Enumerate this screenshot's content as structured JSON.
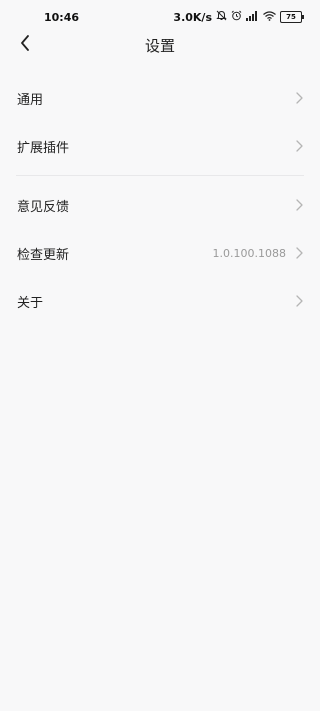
{
  "status_bar": {
    "time": "10:46",
    "network_speed": "3.0K/s",
    "icons": [
      "mute-bell-icon",
      "alarm-icon",
      "signal-icon",
      "wifi-icon",
      "battery-icon"
    ],
    "battery_level": "75"
  },
  "header": {
    "back_icon": "chevron-left-icon",
    "title": "设置"
  },
  "menu": {
    "group1": [
      {
        "label": "通用"
      },
      {
        "label": "扩展插件"
      }
    ],
    "group2": [
      {
        "label": "意见反馈"
      },
      {
        "label": "检查更新",
        "value": "1.0.100.1088"
      },
      {
        "label": "关于"
      }
    ]
  },
  "colors": {
    "background": "#f8f8f9",
    "text": "#222222",
    "secondary_text": "#9a9a9a",
    "chevron": "#b5b5b5",
    "divider": "#e8e8ea"
  }
}
